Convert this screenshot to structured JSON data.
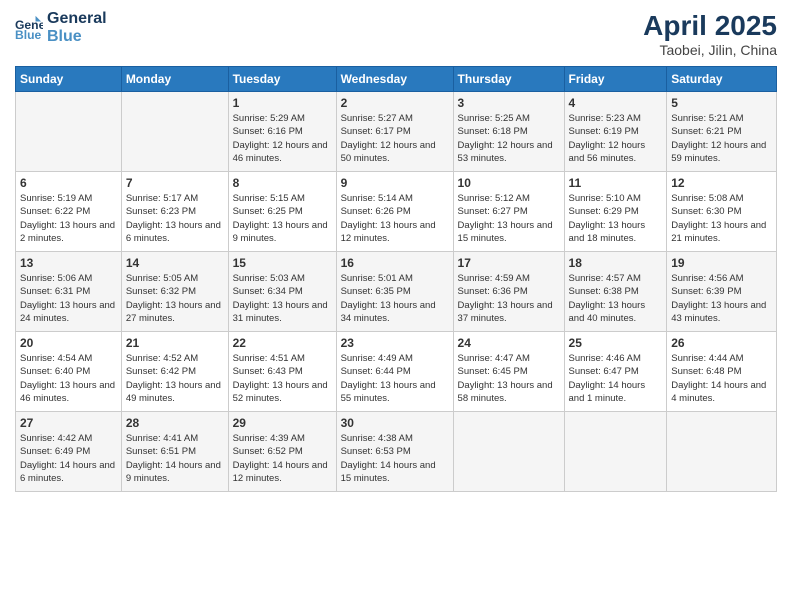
{
  "header": {
    "logo_line1": "General",
    "logo_line2": "Blue",
    "main_title": "April 2025",
    "subtitle": "Taobei, Jilin, China"
  },
  "days_of_week": [
    "Sunday",
    "Monday",
    "Tuesday",
    "Wednesday",
    "Thursday",
    "Friday",
    "Saturday"
  ],
  "weeks": [
    [
      {
        "num": "",
        "sunrise": "",
        "sunset": "",
        "daylight": ""
      },
      {
        "num": "",
        "sunrise": "",
        "sunset": "",
        "daylight": ""
      },
      {
        "num": "1",
        "sunrise": "Sunrise: 5:29 AM",
        "sunset": "Sunset: 6:16 PM",
        "daylight": "Daylight: 12 hours and 46 minutes."
      },
      {
        "num": "2",
        "sunrise": "Sunrise: 5:27 AM",
        "sunset": "Sunset: 6:17 PM",
        "daylight": "Daylight: 12 hours and 50 minutes."
      },
      {
        "num": "3",
        "sunrise": "Sunrise: 5:25 AM",
        "sunset": "Sunset: 6:18 PM",
        "daylight": "Daylight: 12 hours and 53 minutes."
      },
      {
        "num": "4",
        "sunrise": "Sunrise: 5:23 AM",
        "sunset": "Sunset: 6:19 PM",
        "daylight": "Daylight: 12 hours and 56 minutes."
      },
      {
        "num": "5",
        "sunrise": "Sunrise: 5:21 AM",
        "sunset": "Sunset: 6:21 PM",
        "daylight": "Daylight: 12 hours and 59 minutes."
      }
    ],
    [
      {
        "num": "6",
        "sunrise": "Sunrise: 5:19 AM",
        "sunset": "Sunset: 6:22 PM",
        "daylight": "Daylight: 13 hours and 2 minutes."
      },
      {
        "num": "7",
        "sunrise": "Sunrise: 5:17 AM",
        "sunset": "Sunset: 6:23 PM",
        "daylight": "Daylight: 13 hours and 6 minutes."
      },
      {
        "num": "8",
        "sunrise": "Sunrise: 5:15 AM",
        "sunset": "Sunset: 6:25 PM",
        "daylight": "Daylight: 13 hours and 9 minutes."
      },
      {
        "num": "9",
        "sunrise": "Sunrise: 5:14 AM",
        "sunset": "Sunset: 6:26 PM",
        "daylight": "Daylight: 13 hours and 12 minutes."
      },
      {
        "num": "10",
        "sunrise": "Sunrise: 5:12 AM",
        "sunset": "Sunset: 6:27 PM",
        "daylight": "Daylight: 13 hours and 15 minutes."
      },
      {
        "num": "11",
        "sunrise": "Sunrise: 5:10 AM",
        "sunset": "Sunset: 6:29 PM",
        "daylight": "Daylight: 13 hours and 18 minutes."
      },
      {
        "num": "12",
        "sunrise": "Sunrise: 5:08 AM",
        "sunset": "Sunset: 6:30 PM",
        "daylight": "Daylight: 13 hours and 21 minutes."
      }
    ],
    [
      {
        "num": "13",
        "sunrise": "Sunrise: 5:06 AM",
        "sunset": "Sunset: 6:31 PM",
        "daylight": "Daylight: 13 hours and 24 minutes."
      },
      {
        "num": "14",
        "sunrise": "Sunrise: 5:05 AM",
        "sunset": "Sunset: 6:32 PM",
        "daylight": "Daylight: 13 hours and 27 minutes."
      },
      {
        "num": "15",
        "sunrise": "Sunrise: 5:03 AM",
        "sunset": "Sunset: 6:34 PM",
        "daylight": "Daylight: 13 hours and 31 minutes."
      },
      {
        "num": "16",
        "sunrise": "Sunrise: 5:01 AM",
        "sunset": "Sunset: 6:35 PM",
        "daylight": "Daylight: 13 hours and 34 minutes."
      },
      {
        "num": "17",
        "sunrise": "Sunrise: 4:59 AM",
        "sunset": "Sunset: 6:36 PM",
        "daylight": "Daylight: 13 hours and 37 minutes."
      },
      {
        "num": "18",
        "sunrise": "Sunrise: 4:57 AM",
        "sunset": "Sunset: 6:38 PM",
        "daylight": "Daylight: 13 hours and 40 minutes."
      },
      {
        "num": "19",
        "sunrise": "Sunrise: 4:56 AM",
        "sunset": "Sunset: 6:39 PM",
        "daylight": "Daylight: 13 hours and 43 minutes."
      }
    ],
    [
      {
        "num": "20",
        "sunrise": "Sunrise: 4:54 AM",
        "sunset": "Sunset: 6:40 PM",
        "daylight": "Daylight: 13 hours and 46 minutes."
      },
      {
        "num": "21",
        "sunrise": "Sunrise: 4:52 AM",
        "sunset": "Sunset: 6:42 PM",
        "daylight": "Daylight: 13 hours and 49 minutes."
      },
      {
        "num": "22",
        "sunrise": "Sunrise: 4:51 AM",
        "sunset": "Sunset: 6:43 PM",
        "daylight": "Daylight: 13 hours and 52 minutes."
      },
      {
        "num": "23",
        "sunrise": "Sunrise: 4:49 AM",
        "sunset": "Sunset: 6:44 PM",
        "daylight": "Daylight: 13 hours and 55 minutes."
      },
      {
        "num": "24",
        "sunrise": "Sunrise: 4:47 AM",
        "sunset": "Sunset: 6:45 PM",
        "daylight": "Daylight: 13 hours and 58 minutes."
      },
      {
        "num": "25",
        "sunrise": "Sunrise: 4:46 AM",
        "sunset": "Sunset: 6:47 PM",
        "daylight": "Daylight: 14 hours and 1 minute."
      },
      {
        "num": "26",
        "sunrise": "Sunrise: 4:44 AM",
        "sunset": "Sunset: 6:48 PM",
        "daylight": "Daylight: 14 hours and 4 minutes."
      }
    ],
    [
      {
        "num": "27",
        "sunrise": "Sunrise: 4:42 AM",
        "sunset": "Sunset: 6:49 PM",
        "daylight": "Daylight: 14 hours and 6 minutes."
      },
      {
        "num": "28",
        "sunrise": "Sunrise: 4:41 AM",
        "sunset": "Sunset: 6:51 PM",
        "daylight": "Daylight: 14 hours and 9 minutes."
      },
      {
        "num": "29",
        "sunrise": "Sunrise: 4:39 AM",
        "sunset": "Sunset: 6:52 PM",
        "daylight": "Daylight: 14 hours and 12 minutes."
      },
      {
        "num": "30",
        "sunrise": "Sunrise: 4:38 AM",
        "sunset": "Sunset: 6:53 PM",
        "daylight": "Daylight: 14 hours and 15 minutes."
      },
      {
        "num": "",
        "sunrise": "",
        "sunset": "",
        "daylight": ""
      },
      {
        "num": "",
        "sunrise": "",
        "sunset": "",
        "daylight": ""
      },
      {
        "num": "",
        "sunrise": "",
        "sunset": "",
        "daylight": ""
      }
    ]
  ]
}
